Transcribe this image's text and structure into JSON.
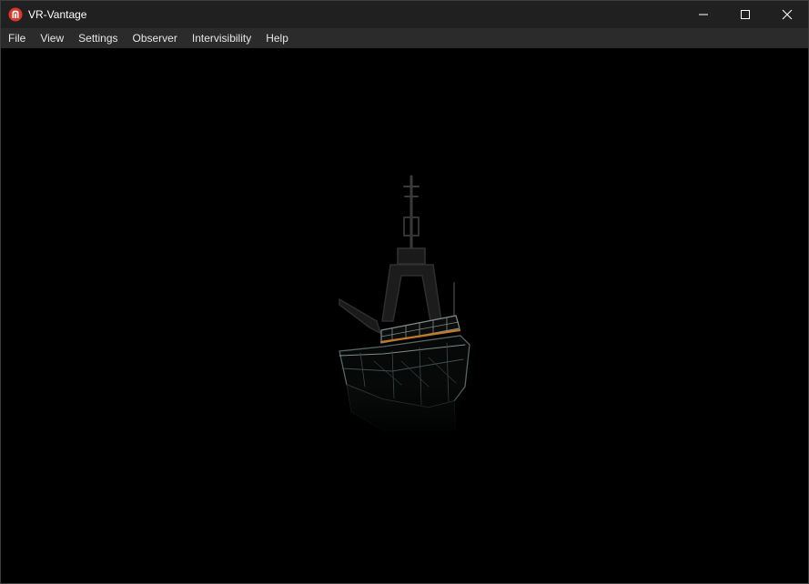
{
  "window": {
    "title": "VR-Vantage",
    "icon": "vr-vantage-logo-icon",
    "controls": [
      "minimize-icon",
      "maximize-icon",
      "close-icon"
    ]
  },
  "menubar": {
    "items": [
      {
        "label": "File"
      },
      {
        "label": "View"
      },
      {
        "label": "Settings"
      },
      {
        "label": "Observer"
      },
      {
        "label": "Intervisibility"
      },
      {
        "label": "Help"
      }
    ]
  },
  "colors": {
    "titlebar": "#202020",
    "menubar": "#2b2b2b",
    "viewport": "#000000",
    "logo_red": "#d9382c",
    "ship_wire": "#8a9a98",
    "ship_deck_accent": "#c07a2a"
  }
}
